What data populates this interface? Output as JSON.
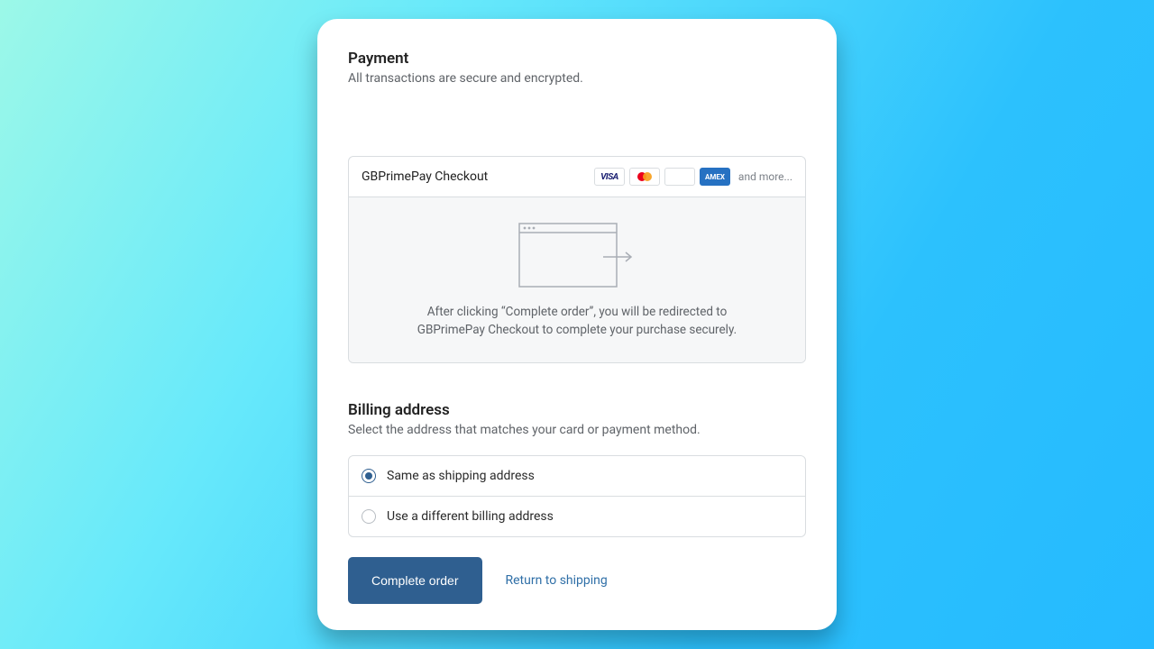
{
  "payment": {
    "title": "Payment",
    "subtitle": "All transactions are secure and encrypted.",
    "method_name": "GBPrimePay Checkout",
    "and_more": "and more...",
    "cards": {
      "visa": "VISA",
      "amex": "AMEX"
    },
    "redirect_text": "After clicking “Complete order”, you will be redirected to GBPrimePay Checkout to complete your purchase securely."
  },
  "billing": {
    "title": "Billing address",
    "subtitle": "Select the address that matches your card or payment method.",
    "option_same": "Same as shipping address",
    "option_diff": "Use a different billing address"
  },
  "actions": {
    "complete": "Complete order",
    "return": "Return to shipping"
  }
}
